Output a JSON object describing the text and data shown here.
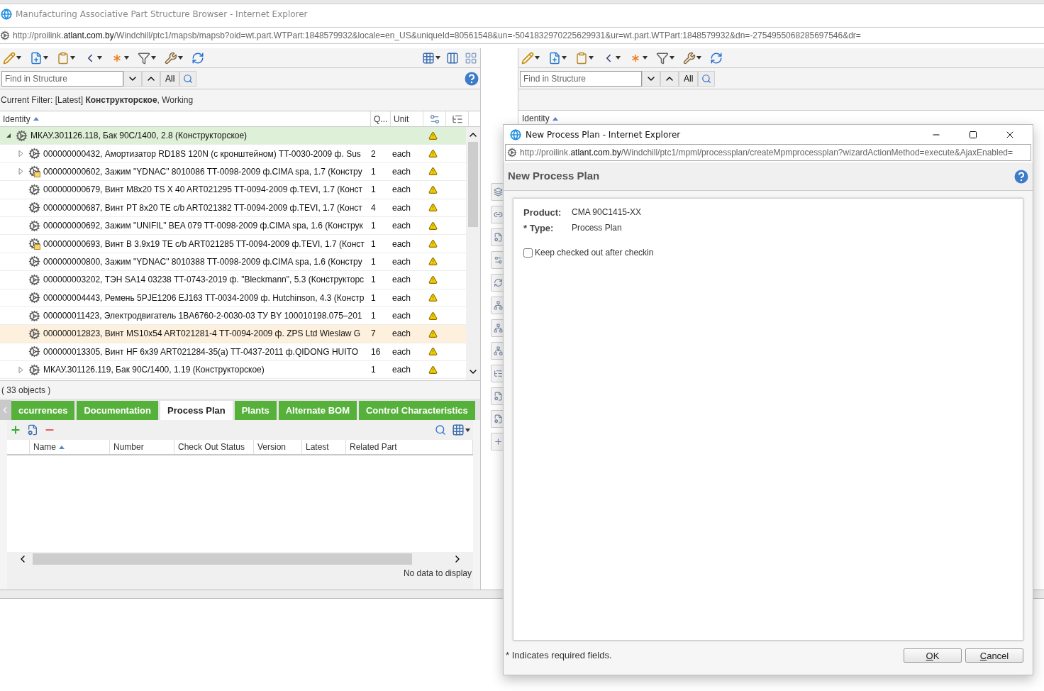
{
  "window": {
    "title": "Manufacturing Associative Part Structure Browser - Internet Explorer"
  },
  "address_bar": {
    "url_start": "http://proilink.",
    "url_domain": "atlant.com.by",
    "url_end": "/Windchill/ptc1/mapsb/mapsb?oid=wt.part.WTPart:1848579932&locale=en_US&uniqueId=80561548&un=-5041832970225629931&ur=wt.part.WTPart:1848579932&dn=-2754955068285697546&dr="
  },
  "left_pane": {
    "find": {
      "placeholder": "Find in Structure",
      "all_label": "All"
    },
    "filter": "Current Filter: [Latest] **Конструкторское**, Working",
    "columns": [
      {
        "label": "Identity",
        "sorted": true
      },
      {
        "label": "Q..."
      },
      {
        "label": "Unit"
      }
    ],
    "rows": [
      {
        "kind": "gear",
        "expanded": true,
        "selected": true,
        "hovered": false,
        "identity": "МКАУ.301126.118, Бак 90С/1400, 2.8 (Конструкторское)"
      },
      {
        "kind": "gear",
        "expanded": false,
        "selected": false,
        "hovered": false,
        "identity": "000000000432, Амортизатор RD18S 120N (с кронштейном) TT-0030-2009 ф. Sus",
        "qty": "2",
        "unit": "each"
      },
      {
        "kind": "gear-note",
        "expanded": false,
        "selected": false,
        "hovered": false,
        "identity": "000000000602, Зажим \"YDNAC\" 8010086 TT-0098-2009 ф.CIMA spa, 1.7 (Констру",
        "qty": "1",
        "unit": "each"
      },
      {
        "kind": "gear",
        "selected": false,
        "hovered": false,
        "identity": "000000000679, Винт M8x20 TS X 40 ART021295 TT-0094-2009 ф.TEVI, 1.7 (Конст",
        "qty": "1",
        "unit": "each"
      },
      {
        "kind": "gear",
        "selected": false,
        "hovered": false,
        "identity": "000000000687, Винт PT 8x20 TE c/b ART021382 TT-0094-2009 ф.TEVI, 1.7 (Конст",
        "qty": "4",
        "unit": "each"
      },
      {
        "kind": "gear",
        "selected": false,
        "hovered": false,
        "identity": "000000000692, Зажим \"UNIFIL\" BEA 079 TT-0098-2009 ф.CIMA spa, 1.6 (Конструк",
        "qty": "1",
        "unit": "each"
      },
      {
        "kind": "gear-note",
        "selected": false,
        "hovered": false,
        "identity": "000000000693, Винт B 3.9x19 TE c/b ART021285 TT-0094-2009 ф.TEVI, 1.7 (Конст",
        "qty": "1",
        "unit": "each"
      },
      {
        "kind": "gear",
        "selected": false,
        "hovered": false,
        "identity": "000000000800, Зажим \"YDNAC\" 8010388 TT-0098-2009 ф.CIMA spa, 1.6 (Констру",
        "qty": "1",
        "unit": "each"
      },
      {
        "kind": "gear",
        "selected": false,
        "hovered": false,
        "identity": "000000003202, ТЭН SA14 03238 TT-0743-2019 ф. \"Bleckmann\", 5.3 (Конструкторс",
        "qty": "1",
        "unit": "each"
      },
      {
        "kind": "gear",
        "selected": false,
        "hovered": false,
        "identity": "000000004443, Ремень 5PJE1206 EJ163 TT-0034-2009 ф. Hutchinson, 4.3 (Констр",
        "qty": "1",
        "unit": "each"
      },
      {
        "kind": "gear",
        "selected": false,
        "hovered": false,
        "identity": "000000011423, Электродвигатель 1BA6760-2-0030-03 ТУ BY 100010198.075–201",
        "qty": "1",
        "unit": "each"
      },
      {
        "kind": "gear",
        "selected": false,
        "hovered": true,
        "identity": "000000012823, Винт MS10x54 ART021281-4 TT-0094-2009 ф. ZPS Ltd Wieslaw G",
        "qty": "7",
        "unit": "each"
      },
      {
        "kind": "gear",
        "selected": false,
        "hovered": false,
        "identity": "000000013305, Винт HF 6x39 ART021284-35(a) TT-0437-2011 ф.QIDONG HUITO",
        "qty": "16",
        "unit": "each"
      },
      {
        "kind": "gear",
        "expanded": false,
        "selected": false,
        "hovered": false,
        "identity": "МКАУ.301126.119, Бак 90С/1400, 1.19 (Конструкторское)",
        "qty": "1",
        "unit": "each"
      }
    ],
    "object_count": "( 33 objects )",
    "tabs": [
      {
        "label": "ccurrences",
        "selected": false
      },
      {
        "label": "Documentation",
        "selected": false
      },
      {
        "label": "Process Plan",
        "selected": true
      },
      {
        "label": "Plants",
        "selected": false
      },
      {
        "label": "Alternate BOM",
        "selected": false
      },
      {
        "label": "Control Characteristics",
        "selected": false
      }
    ],
    "subtable": {
      "columns": [
        {
          "label": "Name",
          "sorted": true
        },
        {
          "label": "Number"
        },
        {
          "label": "Check Out Status"
        },
        {
          "label": "Version"
        },
        {
          "label": "Latest"
        },
        {
          "label": "Related Part"
        }
      ],
      "empty_message": "No data to display"
    }
  },
  "right_pane": {
    "find": {
      "placeholder": "Find in Structure",
      "all_label": "All"
    },
    "columns": [
      {
        "label": "Identity",
        "sorted": true
      }
    ]
  },
  "dialog": {
    "title": "New Process Plan - Internet Explorer",
    "address_bar": {
      "url_start": "http://proilink.",
      "url_domain": "atlant.com.by",
      "url_end": "/Windchill/ptc1/mpml/processplan/createMpmprocessplan?wizardActionMethod=execute&AjaxEnabled="
    },
    "heading": "New Process Plan",
    "fields": [
      {
        "label": "Product:",
        "value": "CMA 90C1415-XX"
      },
      {
        "label": "* Type:",
        "value": "Process Plan"
      }
    ],
    "checkbox": {
      "label": "Keep checked out after checkin",
      "checked": false
    },
    "footnote": "* Indicates required fields.",
    "buttons": [
      "OK",
      "Cancel"
    ]
  }
}
